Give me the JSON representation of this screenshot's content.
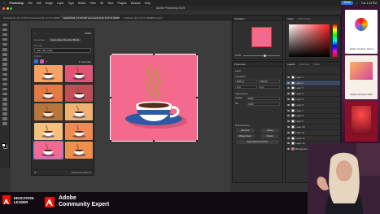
{
  "menubar": {
    "app_name": "Photoshop",
    "items": [
      "File",
      "Edit",
      "Image",
      "Layer",
      "Type",
      "Select",
      "Filter",
      "3D",
      "View",
      "Plugins",
      "Window",
      "Help"
    ],
    "share_label": "Share",
    "clock": "Tue 4:13 PM"
  },
  "window": {
    "title": "Adobe Photoshop 2025"
  },
  "doc_tabs": [
    {
      "label": "GetAdobeIt_12-17-PM (Converted) @ 12.5 % (RGB/Preview)",
      "active": false
    },
    {
      "label": "SafariDraft_17-00-PM (Converted) @ 12.5 % (RGB/Preview)",
      "active": true
    },
    {
      "label": "Untitled-2 @ 12.5 % (RGB/Preview)",
      "active": false
    }
  ],
  "gen_panel": {
    "back_label": "←",
    "done_label": "Done",
    "mode_label": "Generate",
    "mode_value": "Generative Recolor (Beta)",
    "prompt_label": "Prompt",
    "prompt_value": "retro day vibes",
    "colors_label": "Colors",
    "generate_label": "Generate",
    "advanced_label": "Advanced Options",
    "swatch_colors": [
      "#2d72d2",
      "#e04fb5"
    ],
    "thumbs": [
      {
        "bg": "#f9a062",
        "cup": "#ffffff",
        "selected": false
      },
      {
        "bg": "#e05577",
        "cup": "#f4f4f4",
        "selected": false
      },
      {
        "bg": "#e47a43",
        "cup": "#fdf6ea",
        "selected": false
      },
      {
        "bg": "#c14e56",
        "cup": "#ffffff",
        "selected": false
      },
      {
        "bg": "#b8763a",
        "cup": "#fbe7c4",
        "selected": false
      },
      {
        "bg": "#f0b273",
        "cup": "#ffffff",
        "selected": false
      },
      {
        "bg": "#f7c07c",
        "cup": "#ffffff",
        "selected": false
      },
      {
        "bg": "#f08a55",
        "cup": "#fff4ec",
        "selected": false
      },
      {
        "bg": "#f26a93",
        "cup": "#ffffff",
        "selected": true
      },
      {
        "bg": "#ef8f4c",
        "cup": "#ffffff",
        "selected": false
      }
    ]
  },
  "artwork": {
    "bg_color": "#f36a8c",
    "saucer_color": "#2e5aa5",
    "cup_color": "#ffffff",
    "cup_band_color": "#2e5aa5",
    "coffee_color": "#5a2b18",
    "steam_color": "#c98a5a"
  },
  "navigator": {
    "tab_label": "Navigator",
    "zoom_value": "12.5%"
  },
  "color_panel": {
    "tabs": [
      "Color",
      "Color Guide"
    ]
  },
  "properties": {
    "tab_label": "Properties",
    "doc_label": "Layer",
    "transform_label": "Transform",
    "w_value": "1000 px",
    "h_value": "1000 px",
    "x_value": "0 px",
    "y_value": "0 px",
    "appearance_label": "Appearance",
    "opacity_label": "Opacity",
    "opacity_value": "100%",
    "fill_label": "Fill",
    "fill_value": "100%",
    "quick_actions_label": "Quick Actions",
    "qa_buttons": [
      "Remove",
      "Group",
      "Merge Down",
      "Flatten"
    ],
    "export_label": "Quick Export As PNG"
  },
  "layers_panel": {
    "tabs": [
      "Layers",
      "Channels",
      "Paths"
    ],
    "rows": [
      {
        "label": "Layer 1",
        "selected": false
      },
      {
        "label": "Layer 2",
        "selected": true
      },
      {
        "label": "Layer 3",
        "selected": false
      },
      {
        "label": "Layer 4",
        "selected": false
      },
      {
        "label": "Layer 5",
        "selected": false
      },
      {
        "label": "Layer 6",
        "selected": false
      },
      {
        "label": "Layer 7",
        "selected": false
      },
      {
        "label": "Layer 8",
        "selected": false
      },
      {
        "label": "Layer 9",
        "selected": false
      },
      {
        "label": "Layer 10",
        "selected": false
      },
      {
        "label": "Layer 11",
        "selected": false
      },
      {
        "label": "Layer 12",
        "selected": false
      },
      {
        "label": "Layer 13",
        "selected": false
      },
      {
        "label": "Background",
        "selected": false
      }
    ]
  },
  "stream_sidebar": {
    "cards": [
      {
        "caption": "Adobe Creative Cloud",
        "bg": "#ffffff",
        "accent": "#eb1000"
      },
      {
        "caption": "Adobe Animate 2025",
        "bg": "#f6f0e8",
        "accent": "#c23a9a"
      },
      {
        "caption": "",
        "bg": "#8c1025",
        "accent": "#eb1000"
      }
    ]
  },
  "bottom_banner": {
    "badge_line1": "EDUCATION",
    "badge_line2": "LEADER",
    "expert_line1": "Adobe",
    "expert_line2": "Community Expert"
  }
}
